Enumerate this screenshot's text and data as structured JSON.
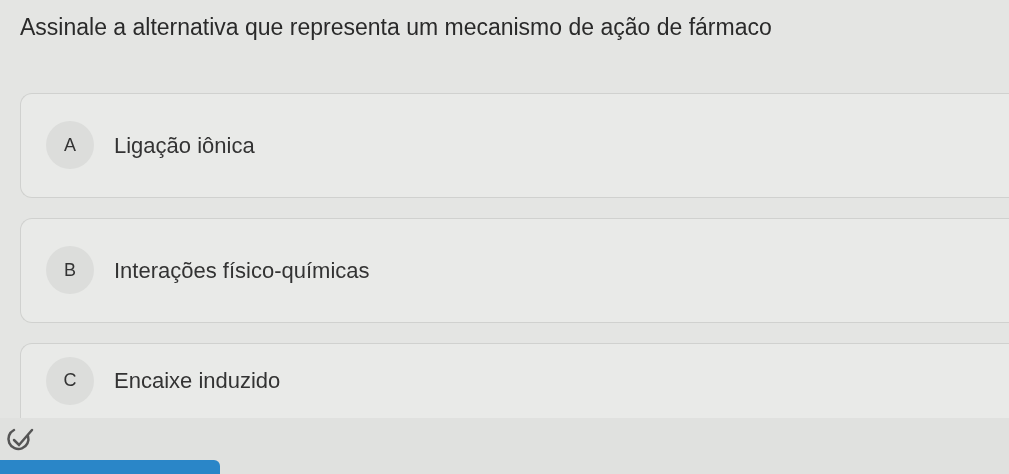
{
  "question": "Assinale a alternativa que representa um mecanismo de ação de fármaco",
  "options": [
    {
      "letter": "A",
      "text": "Ligação iônica"
    },
    {
      "letter": "B",
      "text": "Interações físico-químicas"
    },
    {
      "letter": "C",
      "text": "Encaixe induzido"
    }
  ]
}
